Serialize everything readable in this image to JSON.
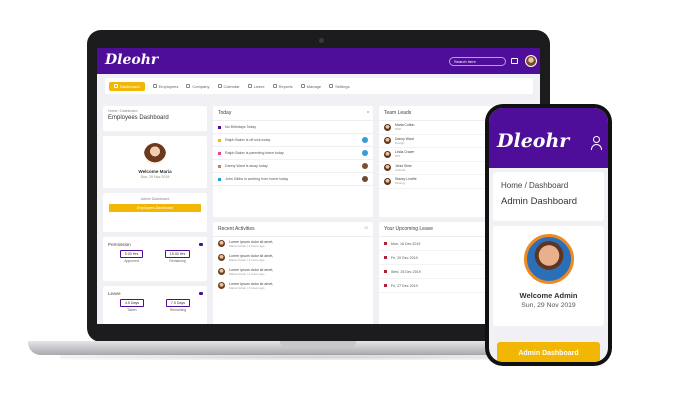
{
  "app": {
    "logo": "Dleohr",
    "search_placeholder": "Search here"
  },
  "nav": [
    "Dashboard",
    "Employees",
    "Company",
    "Calendar",
    "Leave",
    "Reports",
    "Manage",
    "Settings"
  ],
  "breadcrumb": {
    "home": "Home",
    "current": "Dashboard"
  },
  "page_title": "Employees Dashboard",
  "profile": {
    "welcome": "Welcome Maria",
    "date": "Sun, 29 Nov 2019"
  },
  "admin": {
    "label": "Admin Dashboard",
    "button": "Employees Dashboard"
  },
  "permission": {
    "title": "Permission",
    "approved": {
      "value": "5.00 Hrs",
      "label": "Approved"
    },
    "remaining": {
      "value": "15.00 Hrs",
      "label": "Remaining"
    }
  },
  "leave": {
    "title": "Leave",
    "taken": {
      "value": "4.5 Days",
      "label": "Taken"
    },
    "remaining": {
      "value": "7.5 Days",
      "label": "Remaining"
    }
  },
  "today": {
    "title": "Today",
    "items": [
      "No Birthdays Today",
      "Ralph Baker is off sick today",
      "Ralph Baker is parenting leave today",
      "Danny Ward is away today",
      "John Gibbs is working from home today"
    ]
  },
  "recent": {
    "title": "Recent Activities",
    "count": "10",
    "items": [
      {
        "text": "Lorem ipsum dolor sit amet,",
        "meta": "Maria Cotton | 2 hours ago"
      },
      {
        "text": "Lorem ipsum dolor sit amet,",
        "meta": "Maria Cotton | 2 hours ago"
      },
      {
        "text": "Lorem ipsum dolor sit amet,",
        "meta": "Maria Cotton | 2 hours ago"
      },
      {
        "text": "Lorem ipsum dolor sit amet,",
        "meta": "Maria Cotton | 2 hours ago"
      }
    ]
  },
  "team_leads": {
    "title": "Team Leads",
    "items": [
      {
        "name": "Maria Cotton",
        "role": "PHP"
      },
      {
        "name": "Danny Ward",
        "role": "Design"
      },
      {
        "name": "Linda Craver",
        "role": "IOS"
      },
      {
        "name": "Jenni Sims",
        "role": "Android"
      },
      {
        "name": "Stacey Linville",
        "role": "Testing"
      }
    ]
  },
  "upcoming_leave": {
    "title": "Your Upcoming Leave",
    "items": [
      "Mon, 16 Dec 2019",
      "Fri, 20 Dec 2019",
      "Wed, 25 Dec 2019",
      "Fri, 27 Dec 2019"
    ]
  },
  "phone": {
    "logo": "Dleohr",
    "breadcrumb": "Home  /  Dashboard",
    "title": "Admin Dashboard",
    "welcome": "Welcome Admin",
    "date": "Sun, 29 Nov 2019",
    "button": "Admin Dashboard"
  },
  "colors": {
    "brand": "#4f0e9a",
    "accent": "#f2b705",
    "leave_marker": "#b0203a"
  }
}
